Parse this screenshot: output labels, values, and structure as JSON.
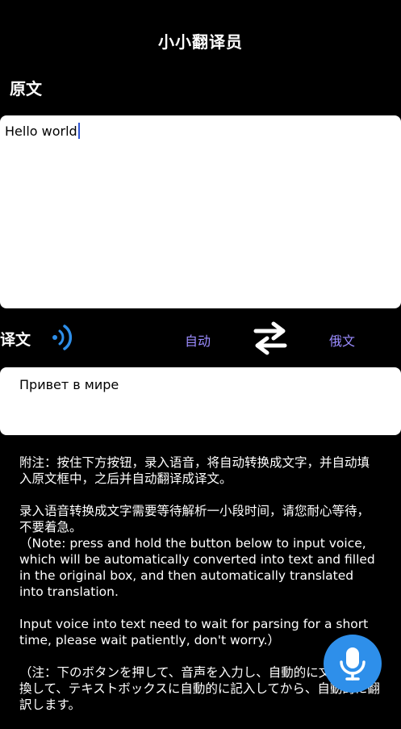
{
  "header": {
    "title": "小小翻译员"
  },
  "source": {
    "label": "原文",
    "text": "Hello world"
  },
  "target": {
    "label": "译文",
    "text": "Привет в мире",
    "from_lang": "自动",
    "to_lang": "俄文"
  },
  "notes": {
    "zh_1": "附注：按住下方按钮，录入语音，将自动转换成文字，并自动填入原文框中，之后并自动翻译成译文。",
    "zh_2": "录入语音转换成文字需要等待解析一小段时间，请您耐心等待，不要着急。",
    "en_1": "（Note: press and hold the button below to input voice, which will be automatically converted into text and filled in the original box, and then automatically translated into translation.",
    "en_2": "Input voice into text need to wait for parsing for a short time, please wait patiently, don't worry.）",
    "ja_1": "（注：下のボタンを押して、音声を入力し、自動的に文字に変換して、テキストボックスに自動的に記入してから、自動的に翻訳します。"
  },
  "icons": {
    "speaker": "speaker-icon",
    "swap": "swap-icon",
    "mic": "microphone-icon"
  },
  "colors": {
    "accent_text": "#9b8cff",
    "speaker_blue": "#2e8fea",
    "mic_button": "#2e8fea",
    "caret": "#2f55d4"
  }
}
